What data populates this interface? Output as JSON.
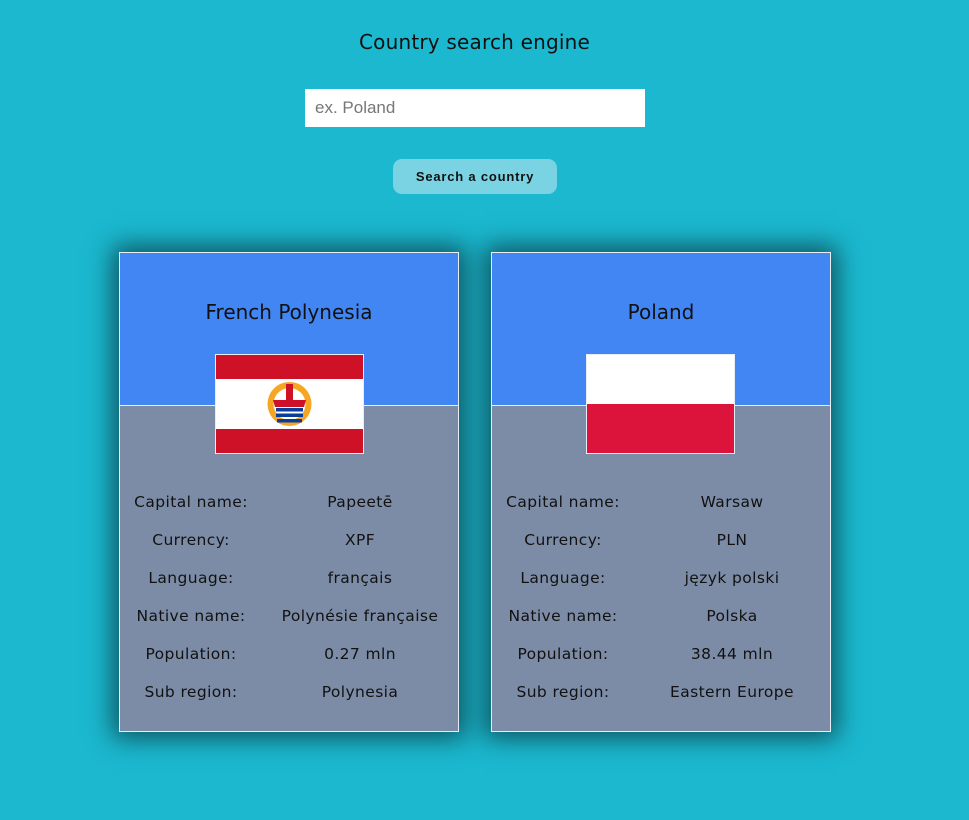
{
  "header": {
    "title": "Country search engine"
  },
  "search": {
    "placeholder": "ex. Poland",
    "value": "",
    "button_label": "Search a country"
  },
  "colors": {
    "background": "#1bb8cf",
    "card_header": "#4286f4",
    "card_body": "#7d8ca6",
    "button": "#7ad3e3"
  },
  "labels": {
    "capital": "Capital name:",
    "currency": "Currency:",
    "language": "Language:",
    "native_name": "Native name:",
    "population": "Population:",
    "sub_region": "Sub region:"
  },
  "cards": [
    {
      "name": "French Polynesia",
      "flag_icon": "french-polynesia-flag",
      "capital": "Papeetē",
      "currency": "XPF",
      "language": "français",
      "native_name": "Polynésie française",
      "population": "0.27 mln",
      "sub_region": "Polynesia"
    },
    {
      "name": "Poland",
      "flag_icon": "poland-flag",
      "capital": "Warsaw",
      "currency": "PLN",
      "language": "język polski",
      "native_name": "Polska",
      "population": "38.44 mln",
      "sub_region": "Eastern Europe"
    }
  ]
}
